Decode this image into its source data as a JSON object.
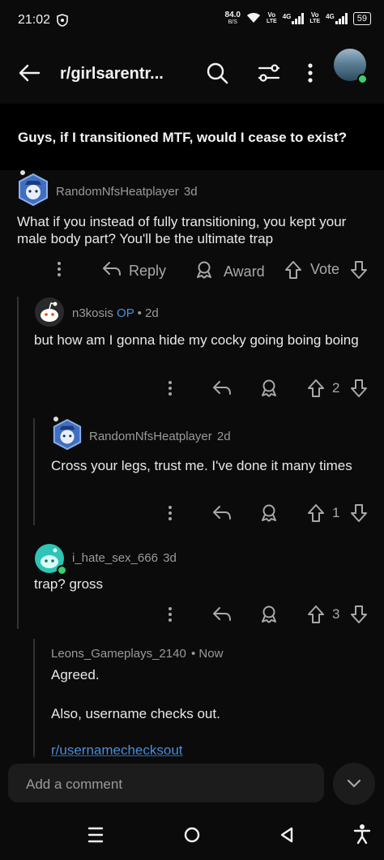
{
  "status_bar": {
    "time": "21:02",
    "speed": "84.0",
    "speed_unit": "B/S",
    "net1_top": "Vo",
    "net1_bottom": "LTE",
    "net1_gen": "4G",
    "net2_top": "Vo",
    "net2_bottom": "LTE",
    "net2_gen": "4G",
    "battery": "59"
  },
  "header": {
    "subreddit": "r/girlsarentr..."
  },
  "post": {
    "title": "Guys, if I transitioned MTF, would I cease to exist?"
  },
  "comments": [
    {
      "username": "RandomNfsHeatplayer",
      "age": "3d",
      "text": "What if you instead of fully transitioning, you kept your male body part? You'll be the ultimate trap",
      "reply_label": "Reply",
      "award_label": "Award",
      "vote_label": "Vote"
    },
    {
      "username": "n3kosis",
      "op_badge": "OP",
      "age": "• 2d",
      "text": "but how am I gonna hide my cocky going boing boing",
      "votes": "2"
    },
    {
      "username": "RandomNfsHeatplayer",
      "age": "2d",
      "text": "Cross your legs, trust me. I've done it many times",
      "votes": "1"
    },
    {
      "username": "i_hate_sex_666",
      "age": "3d",
      "text": "trap? gross",
      "votes": "3"
    },
    {
      "username": "Leons_Gameplays_2140",
      "age": "• Now",
      "text_line1": "Agreed.",
      "text_line2": "Also, username checks out.",
      "link": "r/usernamechecksout"
    }
  ],
  "comment_input": {
    "placeholder": "Add a comment"
  },
  "colors": {
    "background": "#0b0b0b",
    "accent_link": "#4a8fe0",
    "online": "#3ad06a"
  }
}
